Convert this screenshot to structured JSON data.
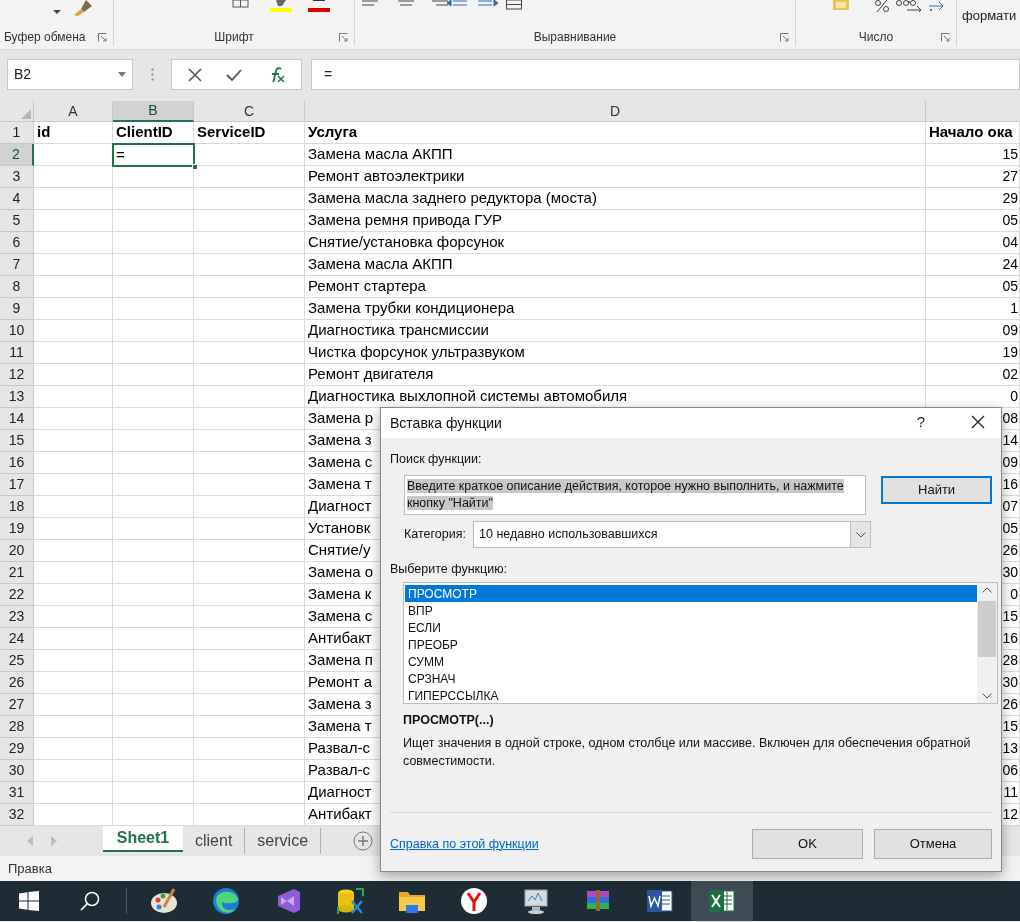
{
  "ribbon": {
    "groups": [
      "Буфер обмена",
      "Шрифт",
      "Выравнивание",
      "Число"
    ],
    "format_label": "формати"
  },
  "formula_bar": {
    "name_box": "B2",
    "formula": "="
  },
  "sheet": {
    "columns": [
      {
        "label": "A",
        "selected": false
      },
      {
        "label": "B",
        "selected": true
      },
      {
        "label": "C",
        "selected": false
      },
      {
        "label": "D",
        "selected": false
      }
    ],
    "rows": [
      {
        "number": "1",
        "kind": "header",
        "selected": false,
        "A": "id",
        "B": "ClientID",
        "C": "ServiceID",
        "D": "Услуга",
        "E": "Начало ока"
      },
      {
        "number": "2",
        "kind": "data",
        "selected": true,
        "B": "=",
        "D": "Замена масла АКПП",
        "E": "15"
      },
      {
        "number": "3",
        "kind": "data",
        "selected": false,
        "D": "Ремонт автоэлектрики",
        "E": "27"
      },
      {
        "number": "4",
        "kind": "data",
        "selected": false,
        "D": "Замена масла заднего редуктора (моста)",
        "E": "29"
      },
      {
        "number": "5",
        "kind": "data",
        "selected": false,
        "D": "Замена ремня привода ГУР",
        "E": "05"
      },
      {
        "number": "6",
        "kind": "data",
        "selected": false,
        "D": "Снятие/установка форсунок",
        "E": "04"
      },
      {
        "number": "7",
        "kind": "data",
        "selected": false,
        "D": "Замена масла АКПП",
        "E": "24"
      },
      {
        "number": "8",
        "kind": "data",
        "selected": false,
        "D": "Ремонт стартера",
        "E": "05"
      },
      {
        "number": "9",
        "kind": "data",
        "selected": false,
        "D": "Замена трубки кондиционера",
        "E": "1"
      },
      {
        "number": "10",
        "kind": "data",
        "selected": false,
        "D": "Диагностика трансмиссии",
        "E": "09"
      },
      {
        "number": "11",
        "kind": "data",
        "selected": false,
        "D": "Чистка форсунок ультразвуком",
        "E": "19"
      },
      {
        "number": "12",
        "kind": "data",
        "selected": false,
        "D": "Ремонт двигателя",
        "E": "02"
      },
      {
        "number": "13",
        "kind": "data",
        "selected": false,
        "D": "Диагностика выхлопной системы автомобиля",
        "E": "0"
      },
      {
        "number": "14",
        "kind": "data",
        "selected": false,
        "D": "Замена р",
        "E": "08"
      },
      {
        "number": "15",
        "kind": "data",
        "selected": false,
        "D": "Замена з",
        "E": "14"
      },
      {
        "number": "16",
        "kind": "data",
        "selected": false,
        "D": "Замена с",
        "E": "09"
      },
      {
        "number": "17",
        "kind": "data",
        "selected": false,
        "D": "Замена т",
        "E": "16"
      },
      {
        "number": "18",
        "kind": "data",
        "selected": false,
        "D": "Диагност",
        "E": "07"
      },
      {
        "number": "19",
        "kind": "data",
        "selected": false,
        "D": "Установк",
        "E": "05"
      },
      {
        "number": "20",
        "kind": "data",
        "selected": false,
        "D": "Снятие/у",
        "E": "26"
      },
      {
        "number": "21",
        "kind": "data",
        "selected": false,
        "D": "Замена о",
        "E": "30"
      },
      {
        "number": "22",
        "kind": "data",
        "selected": false,
        "D": "Замена к",
        "E": "0"
      },
      {
        "number": "23",
        "kind": "data",
        "selected": false,
        "D": "Замена с",
        "E": "15"
      },
      {
        "number": "24",
        "kind": "data",
        "selected": false,
        "D": "Антибакт",
        "E": "16"
      },
      {
        "number": "25",
        "kind": "data",
        "selected": false,
        "D": "Замена п",
        "E": "28"
      },
      {
        "number": "26",
        "kind": "data",
        "selected": false,
        "D": "Ремонт а",
        "E": "30"
      },
      {
        "number": "27",
        "kind": "data",
        "selected": false,
        "D": "Замена з",
        "E": "26"
      },
      {
        "number": "28",
        "kind": "data",
        "selected": false,
        "D": "Замена т",
        "E": "15"
      },
      {
        "number": "29",
        "kind": "data",
        "selected": false,
        "D": "Развал-с",
        "E": "13"
      },
      {
        "number": "30",
        "kind": "data",
        "selected": false,
        "D": "Развал-с",
        "E": "06"
      },
      {
        "number": "31",
        "kind": "data",
        "selected": false,
        "D": "Диагност",
        "E": "11"
      },
      {
        "number": "32",
        "kind": "data",
        "selected": false,
        "D": "Антибакт",
        "E": "12"
      }
    ]
  },
  "sheet_tabs": [
    {
      "label": "Sheet1",
      "selected": true
    },
    {
      "label": "client",
      "selected": false
    },
    {
      "label": "service",
      "selected": false
    }
  ],
  "status_bar": "Правка",
  "taskbar": [
    {
      "kind": "paint",
      "active": false
    },
    {
      "kind": "edge",
      "active": false
    },
    {
      "kind": "studio",
      "active": false
    },
    {
      "kind": "database",
      "active": false
    },
    {
      "kind": "folder",
      "active": false
    },
    {
      "kind": "yandex",
      "active": false
    },
    {
      "kind": "monitor",
      "active": false
    },
    {
      "kind": "archive",
      "active": false
    },
    {
      "kind": "word",
      "active": false
    },
    {
      "kind": "excel",
      "active": true
    }
  ],
  "dialog": {
    "title": "Вставка функции",
    "help": "?",
    "search_label": "Поиск функции:",
    "search_value": "Введите краткое описание действия, которое нужно выполнить, и нажмите кнопку \"Найти\"",
    "search_selected": true,
    "find_button": "Найти",
    "category_label": "Категория:",
    "category_value": "10 недавно использовавшихся",
    "list_label": "Выберите функцию:",
    "functions": [
      {
        "name": "ПРОСМОТР",
        "selected": true
      },
      {
        "name": "ВПР",
        "selected": false
      },
      {
        "name": "ЕСЛИ",
        "selected": false
      },
      {
        "name": "ПРЕОБР",
        "selected": false
      },
      {
        "name": "СУММ",
        "selected": false
      },
      {
        "name": "СРЗНАЧ",
        "selected": false
      },
      {
        "name": "ГИПЕРССЫЛКА",
        "selected": false
      }
    ],
    "signature": "ПРОСМОТР(...)",
    "description": "Ищет значения в одной строке, одном столбце или массиве. Включен для обеспечения обратной совместимости.",
    "help_link": "Справка по этой функции",
    "buttons": [
      "OK",
      "Отмена"
    ]
  }
}
